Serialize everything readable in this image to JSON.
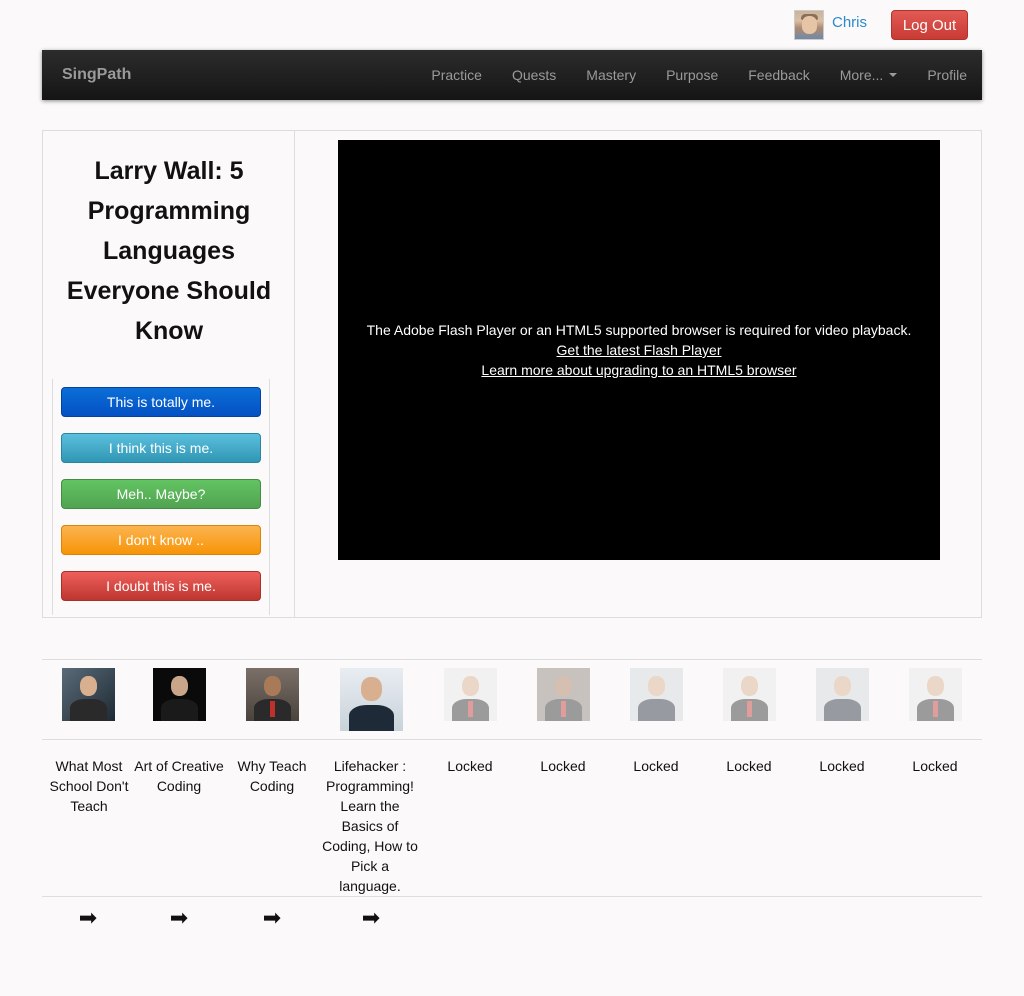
{
  "user": {
    "name": "Chris",
    "logout_label": "Log Out"
  },
  "navbar": {
    "brand": "SingPath",
    "items": [
      "Practice",
      "Quests",
      "Mastery",
      "Purpose",
      "Feedback",
      "More...",
      "Profile"
    ]
  },
  "main": {
    "title": "Larry Wall: 5 Programming Languages Everyone Should Know",
    "choices": [
      "This is totally me.",
      "I think this is me.",
      "Meh.. Maybe?",
      "I don't know ..",
      "I doubt this is me."
    ],
    "video": {
      "message": "The Adobe Flash Player or an HTML5 supported browser is required for video playback.",
      "link1": "Get the latest Flash Player",
      "link2": "Learn more about upgrading to an HTML5 browser"
    }
  },
  "videos": [
    {
      "title": "What Most School Don't Teach"
    },
    {
      "title": "Art of Creative Coding"
    },
    {
      "title": "Why Teach Coding"
    },
    {
      "title": "Lifehacker : Programming! Learn the Basics of Coding, How to Pick a language."
    },
    {
      "title": "Locked"
    },
    {
      "title": "Locked"
    },
    {
      "title": "Locked"
    },
    {
      "title": "Locked"
    },
    {
      "title": "Locked"
    },
    {
      "title": "Locked"
    }
  ],
  "arrow_icon": "➡",
  "colors": {
    "link": "#2a8bcc",
    "danger": "#d9534f",
    "navbar": "#1b1b1b"
  }
}
